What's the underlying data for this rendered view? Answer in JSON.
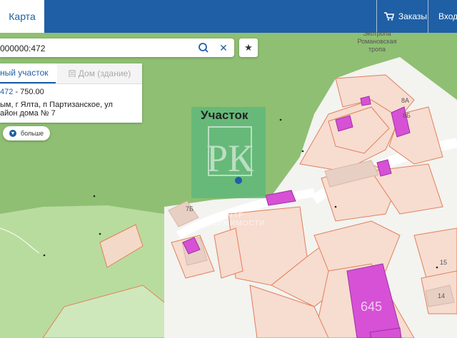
{
  "header": {
    "map_tab_label": "Карта",
    "orders_label": "Заказы",
    "login_label": "Вход"
  },
  "search": {
    "value": "000000:472"
  },
  "panel": {
    "tab_land_label": "ный участок",
    "tab_building_label": "Дом (здание)",
    "cadastral_suffix": "472",
    "area_text": " - 750.00",
    "address_line1": "ым, г Ялта, п Партизанское, ул",
    "address_line2": "айон дома № 7",
    "more_label": "больше"
  },
  "map": {
    "plot_label": "Участок",
    "trail_label": "Экотропа Романовская тропа",
    "building_labels": [
      "7Б",
      "8А",
      "8Б",
      "15",
      "14"
    ],
    "watermark_letters": "РК",
    "watermark_text": "ЦЕНТР НЕДВИЖИМОСТИ",
    "ad_fragment": "645"
  },
  "colors": {
    "header_blue": "#1f5fa5",
    "forest_green": "#8fbf73",
    "parcel_fill": "#f7dcd0",
    "parcel_stroke": "#e0805a",
    "building_magenta": "#d651d6",
    "selected_plot": "#5cb87a"
  }
}
